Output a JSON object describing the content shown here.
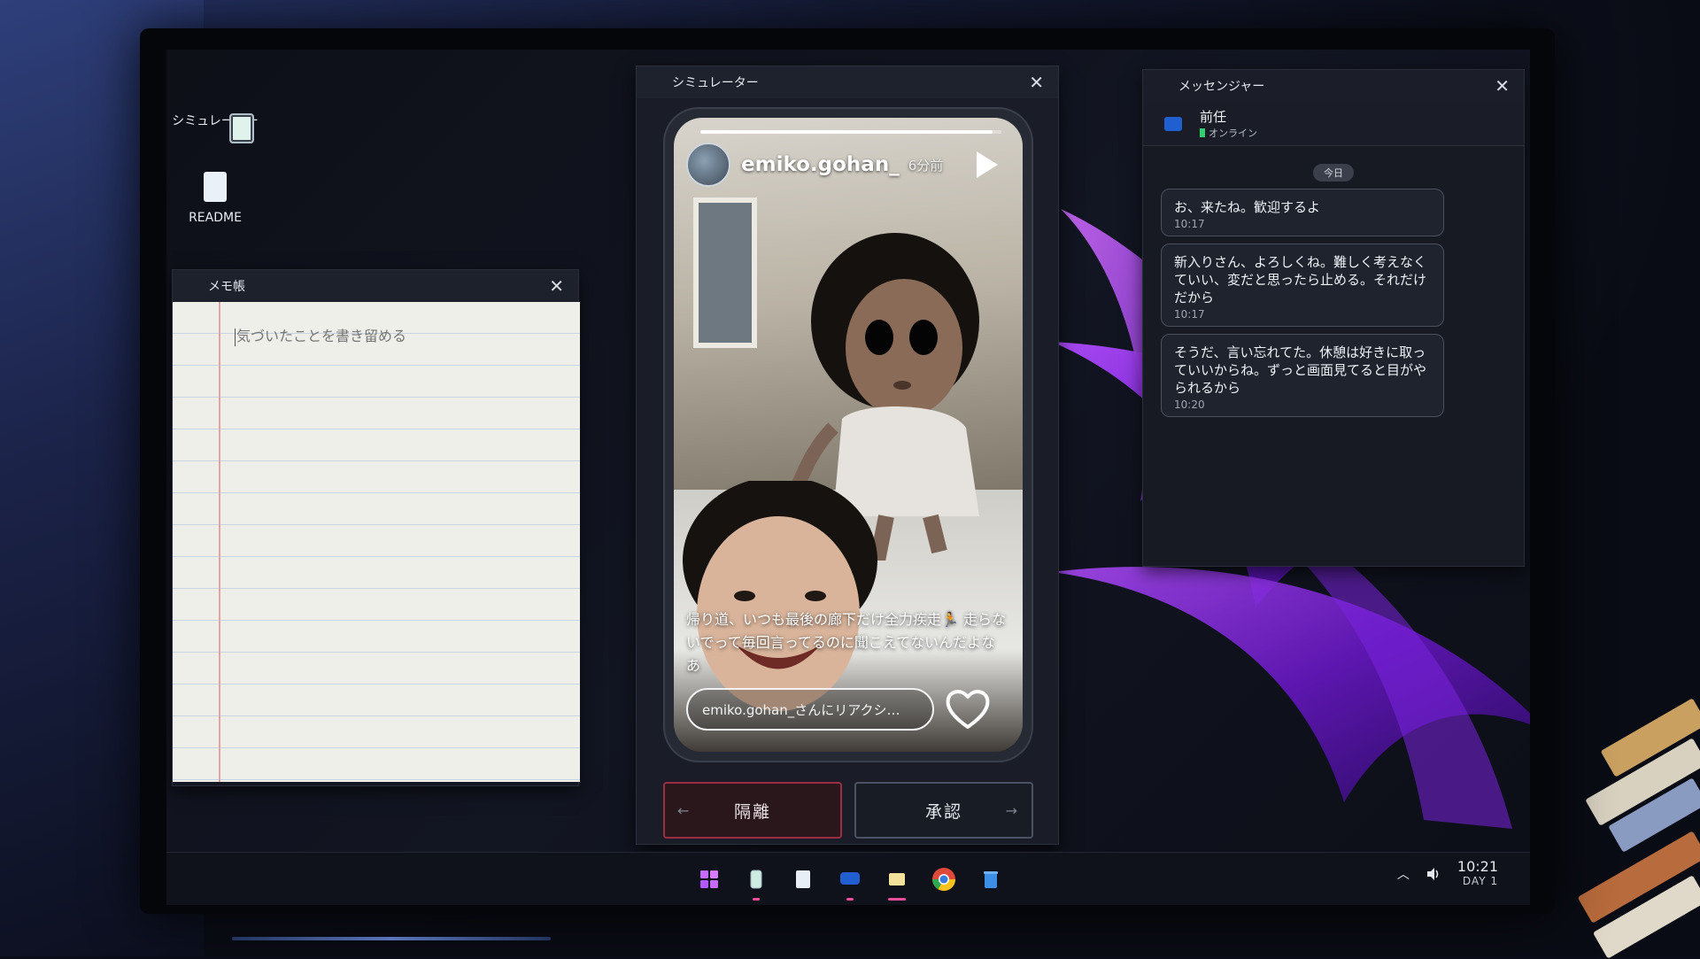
{
  "desktop": {
    "icons": [
      {
        "label": "シミュレーター",
        "icon": "phone-app-icon"
      },
      {
        "label": "README",
        "icon": "document-icon"
      }
    ]
  },
  "notepad": {
    "title": "メモ帳",
    "placeholder": "気づいたことを書き留める"
  },
  "simulator": {
    "title": "シミュレーター",
    "story": {
      "username": "emiko.gohan_",
      "time_ago": "6分前",
      "progress": 0.97,
      "caption": "帰り道、いつも最後の廊下だけ全力疾走🏃 走らないでって毎回言ってるのに聞こえてないんだよなあ",
      "reply_placeholder": "emiko.gohan_さんにリアクシ…"
    },
    "reject_label": "隔離",
    "accept_label": "承認",
    "reject_arrow": "←",
    "accept_arrow": "→"
  },
  "messenger": {
    "title": "メッセンジャー",
    "contact_name": "前任",
    "contact_status": "オンライン",
    "day_label": "今日",
    "messages": [
      {
        "text": "お、来たね。歓迎するよ",
        "time": "10:17"
      },
      {
        "text": "新入りさん、よろしくね。難しく考えなくていい、変だと思ったら止める。それだけだから",
        "time": "10:17"
      },
      {
        "text": "そうだ、言い忘れてた。休憩は好きに取っていいからね。ずっと画面見てると目がやられるから",
        "time": "10:20"
      }
    ]
  },
  "taskbar": {
    "time": "10:21",
    "day": "DAY 1",
    "apps": [
      "start-icon",
      "simulator-icon",
      "notepad-icon",
      "messenger-icon",
      "folder-icon",
      "browser-icon",
      "trash-icon"
    ]
  },
  "colors": {
    "accent_pink": "#e94d9b",
    "reject_border": "#9b2e44",
    "online_green": "#2fd070"
  }
}
